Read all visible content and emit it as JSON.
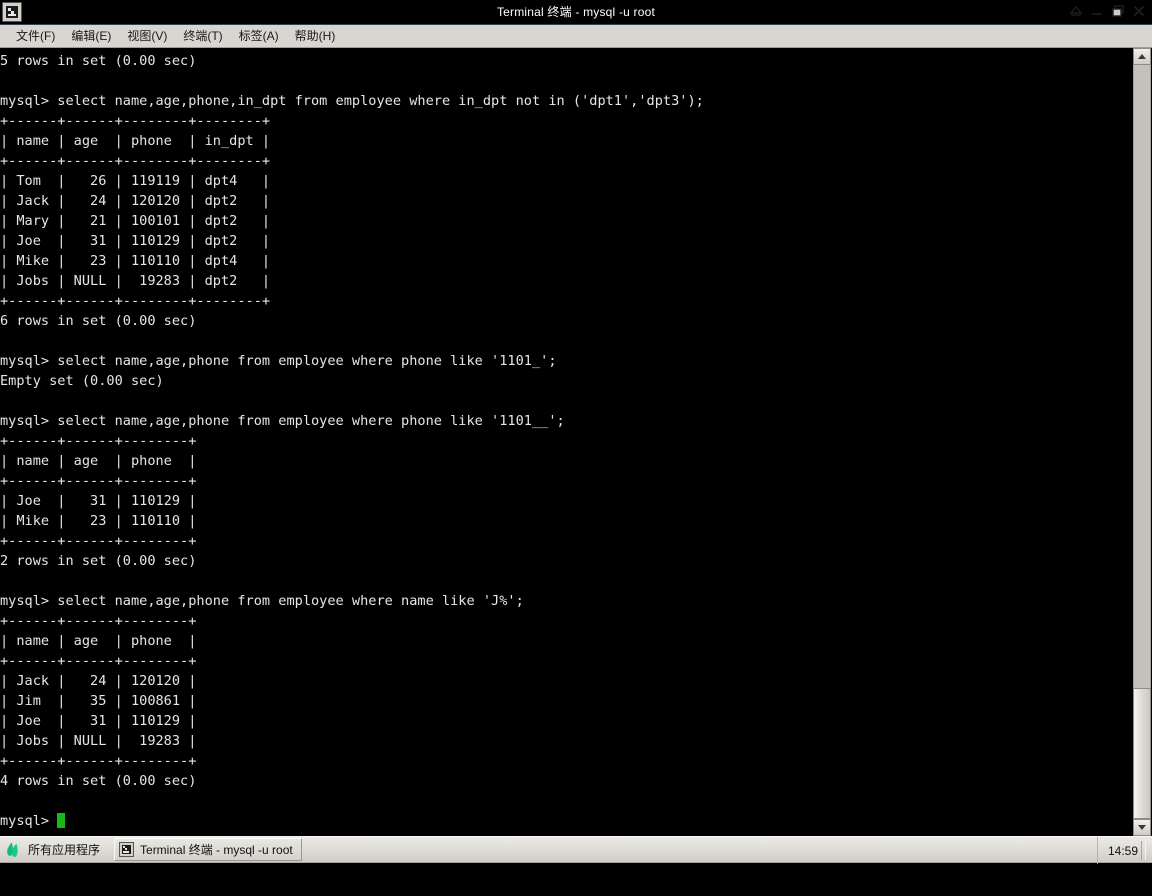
{
  "window": {
    "title": "Terminal 终端 - mysql -u root",
    "icon": "terminal-icon",
    "buttons": [
      {
        "name": "shade-button",
        "glyph": "eject"
      },
      {
        "name": "minimize-button",
        "glyph": "minimize"
      },
      {
        "name": "maximize-button",
        "glyph": "maximize"
      },
      {
        "name": "close-button",
        "glyph": "close"
      }
    ]
  },
  "menubar": {
    "items": [
      {
        "label": "文件(F)",
        "mnemonic": "F"
      },
      {
        "label": "编辑(E)",
        "mnemonic": "E"
      },
      {
        "label": "视图(V)",
        "mnemonic": "V"
      },
      {
        "label": "终端(T)",
        "mnemonic": "T"
      },
      {
        "label": "标签(A)",
        "mnemonic": "A"
      },
      {
        "label": "帮助(H)",
        "mnemonic": "H"
      }
    ]
  },
  "terminal": {
    "foreground": "#e6e6e6",
    "background": "#000000",
    "cursor_color": "#17ba17",
    "prompt": "mysql>",
    "lines": [
      "5 rows in set (0.00 sec)",
      "",
      "mysql> select name,age,phone,in_dpt from employee where in_dpt not in ('dpt1','dpt3');",
      "+------+------+--------+--------+",
      "| name | age  | phone  | in_dpt |",
      "+------+------+--------+--------+",
      "| Tom  |   26 | 119119 | dpt4   |",
      "| Jack |   24 | 120120 | dpt2   |",
      "| Mary |   21 | 100101 | dpt2   |",
      "| Joe  |   31 | 110129 | dpt2   |",
      "| Mike |   23 | 110110 | dpt4   |",
      "| Jobs | NULL |  19283 | dpt2   |",
      "+------+------+--------+--------+",
      "6 rows in set (0.00 sec)",
      "",
      "mysql> select name,age,phone from employee where phone like '1101_';",
      "Empty set (0.00 sec)",
      "",
      "mysql> select name,age,phone from employee where phone like '1101__';",
      "+------+------+--------+",
      "| name | age  | phone  |",
      "+------+------+--------+",
      "| Joe  |   31 | 110129 |",
      "| Mike |   23 | 110110 |",
      "+------+------+--------+",
      "2 rows in set (0.00 sec)",
      "",
      "mysql> select name,age,phone from employee where name like 'J%';",
      "+------+------+--------+",
      "| name | age  | phone  |",
      "+------+------+--------+",
      "| Jack |   24 | 120120 |",
      "| Jim  |   35 | 100861 |",
      "| Joe  |   31 | 110129 |",
      "| Jobs | NULL |  19283 |",
      "+------+------+--------+",
      "4 rows in set (0.00 sec)",
      ""
    ],
    "prompt_line": "mysql> "
  },
  "taskbar": {
    "apps_label": "所有应用程序",
    "apps_icon": "leaf-logo-icon",
    "window_button": "Terminal 终端 - mysql -u root",
    "clock": "14:59"
  }
}
